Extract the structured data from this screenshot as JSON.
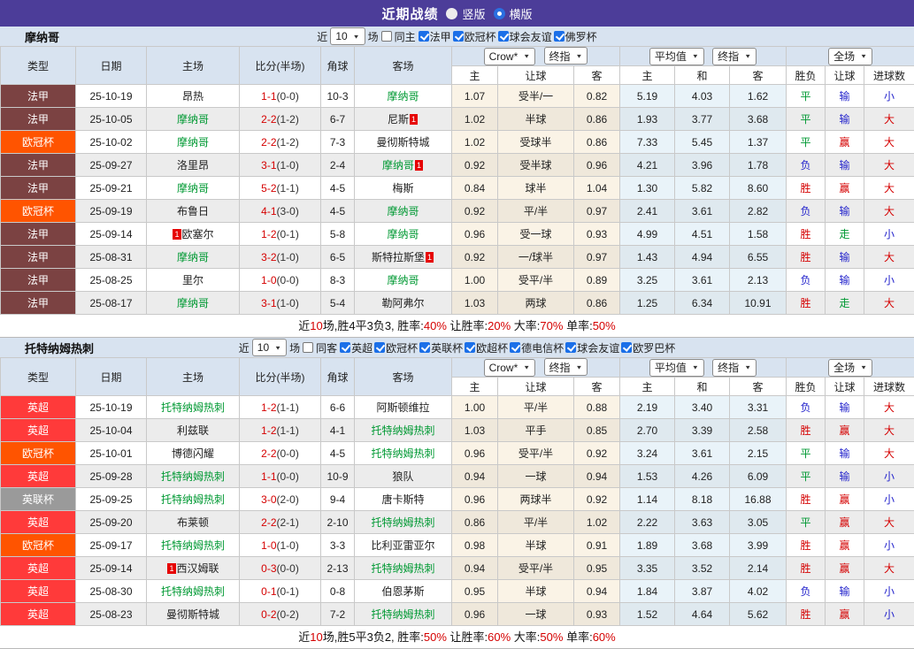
{
  "topbar": {
    "title": "近期战绩",
    "radio_vertical": "竖版",
    "radio_horizontal": "横版",
    "selected": "横版"
  },
  "table_header": {
    "col_type": "类型",
    "col_date": "日期",
    "col_home": "主场",
    "col_score": "比分(半场)",
    "col_corner": "角球",
    "col_away": "客场",
    "dd_crow": "Crow*",
    "dd_final1": "终指",
    "dd_avg": "平均值",
    "dd_final2": "终指",
    "dd_full": "全场",
    "sub": [
      "主",
      "让球",
      "客",
      "主",
      "和",
      "客",
      "胜负",
      "让球",
      "进球数"
    ]
  },
  "colors": {
    "topbar_bg": "#4c3d99",
    "section_bg": "#d8e3f0",
    "league": {
      "ligue1": "#7b4242",
      "ucl": "#ff5400",
      "epl": "#ff3a3a",
      "efl": "#9a9a9a"
    },
    "result": {
      "r": "#d50000",
      "g": "#009933",
      "b": "#2323cc"
    },
    "team_green": "#009933",
    "score_red": "#d50000",
    "badge_bg": "#e60000",
    "checkbox_blue": "#1b6fe8"
  },
  "sections": [
    {
      "team": "摩纳哥",
      "filter": {
        "near_label": "近",
        "count": "10",
        "matches_label": "场",
        "same_label": "同主",
        "leagues": [
          "法甲",
          "欧冠杯",
          "球会友谊",
          "佛罗杯"
        ]
      },
      "rows": [
        {
          "league": "法甲",
          "lc": "ligue1",
          "date": "25-10-19",
          "home": {
            "name": "昂热"
          },
          "score": "1-1",
          "half": "(0-0)",
          "corner": "10-3",
          "away": {
            "name": "摩纳哥",
            "green": true
          },
          "o": [
            "1.07",
            "受半/一",
            "0.82"
          ],
          "a": [
            "5.19",
            "4.03",
            "1.62"
          ],
          "r": [
            [
              "平",
              "g"
            ],
            [
              "输",
              "b"
            ],
            [
              "小",
              "b"
            ]
          ]
        },
        {
          "league": "法甲",
          "lc": "ligue1",
          "date": "25-10-05",
          "home": {
            "name": "摩纳哥",
            "green": true
          },
          "score": "2-2",
          "half": "(1-2)",
          "corner": "6-7",
          "away": {
            "name": "尼斯",
            "badge": "1",
            "badge_pos": "post"
          },
          "o": [
            "1.02",
            "半球",
            "0.86"
          ],
          "a": [
            "1.93",
            "3.77",
            "3.68"
          ],
          "r": [
            [
              "平",
              "g"
            ],
            [
              "输",
              "b"
            ],
            [
              "大",
              "r"
            ]
          ]
        },
        {
          "league": "欧冠杯",
          "lc": "ucl",
          "date": "25-10-02",
          "home": {
            "name": "摩纳哥",
            "green": true
          },
          "score": "2-2",
          "half": "(1-2)",
          "corner": "7-3",
          "away": {
            "name": "曼彻斯特城"
          },
          "o": [
            "1.02",
            "受球半",
            "0.86"
          ],
          "a": [
            "7.33",
            "5.45",
            "1.37"
          ],
          "r": [
            [
              "平",
              "g"
            ],
            [
              "赢",
              "r"
            ],
            [
              "大",
              "r"
            ]
          ]
        },
        {
          "league": "法甲",
          "lc": "ligue1",
          "date": "25-09-27",
          "home": {
            "name": "洛里昂"
          },
          "score": "3-1",
          "half": "(1-0)",
          "corner": "2-4",
          "away": {
            "name": "摩纳哥",
            "green": true,
            "badge": "1",
            "badge_pos": "post"
          },
          "o": [
            "0.92",
            "受半球",
            "0.96"
          ],
          "a": [
            "4.21",
            "3.96",
            "1.78"
          ],
          "r": [
            [
              "负",
              "b"
            ],
            [
              "输",
              "b"
            ],
            [
              "大",
              "r"
            ]
          ]
        },
        {
          "league": "法甲",
          "lc": "ligue1",
          "date": "25-09-21",
          "home": {
            "name": "摩纳哥",
            "green": true
          },
          "score": "5-2",
          "half": "(1-1)",
          "corner": "4-5",
          "away": {
            "name": "梅斯"
          },
          "o": [
            "0.84",
            "球半",
            "1.04"
          ],
          "a": [
            "1.30",
            "5.82",
            "8.60"
          ],
          "r": [
            [
              "胜",
              "r"
            ],
            [
              "赢",
              "r"
            ],
            [
              "大",
              "r"
            ]
          ]
        },
        {
          "league": "欧冠杯",
          "lc": "ucl",
          "date": "25-09-19",
          "home": {
            "name": "布鲁日"
          },
          "score": "4-1",
          "half": "(3-0)",
          "corner": "4-5",
          "away": {
            "name": "摩纳哥",
            "green": true
          },
          "o": [
            "0.92",
            "平/半",
            "0.97"
          ],
          "a": [
            "2.41",
            "3.61",
            "2.82"
          ],
          "r": [
            [
              "负",
              "b"
            ],
            [
              "输",
              "b"
            ],
            [
              "大",
              "r"
            ]
          ]
        },
        {
          "league": "法甲",
          "lc": "ligue1",
          "date": "25-09-14",
          "home": {
            "name": "欧塞尔",
            "badge": "1",
            "badge_pos": "pre"
          },
          "score": "1-2",
          "half": "(0-1)",
          "corner": "5-8",
          "away": {
            "name": "摩纳哥",
            "green": true
          },
          "o": [
            "0.96",
            "受一球",
            "0.93"
          ],
          "a": [
            "4.99",
            "4.51",
            "1.58"
          ],
          "r": [
            [
              "胜",
              "r"
            ],
            [
              "走",
              "g"
            ],
            [
              "小",
              "b"
            ]
          ]
        },
        {
          "league": "法甲",
          "lc": "ligue1",
          "date": "25-08-31",
          "home": {
            "name": "摩纳哥",
            "green": true
          },
          "score": "3-2",
          "half": "(1-0)",
          "corner": "6-5",
          "away": {
            "name": "斯特拉斯堡",
            "badge": "1",
            "badge_pos": "post"
          },
          "o": [
            "0.92",
            "一/球半",
            "0.97"
          ],
          "a": [
            "1.43",
            "4.94",
            "6.55"
          ],
          "r": [
            [
              "胜",
              "r"
            ],
            [
              "输",
              "b"
            ],
            [
              "大",
              "r"
            ]
          ]
        },
        {
          "league": "法甲",
          "lc": "ligue1",
          "date": "25-08-25",
          "home": {
            "name": "里尔"
          },
          "score": "1-0",
          "half": "(0-0)",
          "corner": "8-3",
          "away": {
            "name": "摩纳哥",
            "green": true
          },
          "o": [
            "1.00",
            "受平/半",
            "0.89"
          ],
          "a": [
            "3.25",
            "3.61",
            "2.13"
          ],
          "r": [
            [
              "负",
              "b"
            ],
            [
              "输",
              "b"
            ],
            [
              "小",
              "b"
            ]
          ]
        },
        {
          "league": "法甲",
          "lc": "ligue1",
          "date": "25-08-17",
          "home": {
            "name": "摩纳哥",
            "green": true
          },
          "score": "3-1",
          "half": "(1-0)",
          "corner": "5-4",
          "away": {
            "name": "勒阿弗尔"
          },
          "o": [
            "1.03",
            "两球",
            "0.86"
          ],
          "a": [
            "1.25",
            "6.34",
            "10.91"
          ],
          "r": [
            [
              "胜",
              "r"
            ],
            [
              "走",
              "g"
            ],
            [
              "大",
              "r"
            ]
          ]
        }
      ],
      "summary": [
        [
          "近",
          "k"
        ],
        [
          "10",
          "r"
        ],
        [
          "场,胜4平3负3, 胜率:",
          "k"
        ],
        [
          "40%",
          "r"
        ],
        [
          " 让胜率:",
          "k"
        ],
        [
          "20%",
          "r"
        ],
        [
          " 大率:",
          "k"
        ],
        [
          "70%",
          "r"
        ],
        [
          " 单率:",
          "k"
        ],
        [
          "50%",
          "r"
        ]
      ]
    },
    {
      "team": "托特纳姆热刺",
      "filter": {
        "near_label": "近",
        "count": "10",
        "matches_label": "场",
        "same_label": "同客",
        "leagues": [
          "英超",
          "欧冠杯",
          "英联杯",
          "欧超杯",
          "德电信杯",
          "球会友谊",
          "欧罗巴杯"
        ]
      },
      "rows": [
        {
          "league": "英超",
          "lc": "epl",
          "date": "25-10-19",
          "home": {
            "name": "托特纳姆热刺",
            "green": true
          },
          "score": "1-2",
          "half": "(1-1)",
          "corner": "6-6",
          "away": {
            "name": "阿斯顿维拉"
          },
          "o": [
            "1.00",
            "平/半",
            "0.88"
          ],
          "a": [
            "2.19",
            "3.40",
            "3.31"
          ],
          "r": [
            [
              "负",
              "b"
            ],
            [
              "输",
              "b"
            ],
            [
              "大",
              "r"
            ]
          ]
        },
        {
          "league": "英超",
          "lc": "epl",
          "date": "25-10-04",
          "home": {
            "name": "利兹联"
          },
          "score": "1-2",
          "half": "(1-1)",
          "corner": "4-1",
          "away": {
            "name": "托特纳姆热刺",
            "green": true
          },
          "o": [
            "1.03",
            "平手",
            "0.85"
          ],
          "a": [
            "2.70",
            "3.39",
            "2.58"
          ],
          "r": [
            [
              "胜",
              "r"
            ],
            [
              "赢",
              "r"
            ],
            [
              "大",
              "r"
            ]
          ]
        },
        {
          "league": "欧冠杯",
          "lc": "ucl",
          "date": "25-10-01",
          "home": {
            "name": "博德闪耀"
          },
          "score": "2-2",
          "half": "(0-0)",
          "corner": "4-5",
          "away": {
            "name": "托特纳姆热刺",
            "green": true
          },
          "o": [
            "0.96",
            "受平/半",
            "0.92"
          ],
          "a": [
            "3.24",
            "3.61",
            "2.15"
          ],
          "r": [
            [
              "平",
              "g"
            ],
            [
              "输",
              "b"
            ],
            [
              "大",
              "r"
            ]
          ]
        },
        {
          "league": "英超",
          "lc": "epl",
          "date": "25-09-28",
          "home": {
            "name": "托特纳姆热刺",
            "green": true
          },
          "score": "1-1",
          "half": "(0-0)",
          "corner": "10-9",
          "away": {
            "name": "狼队"
          },
          "o": [
            "0.94",
            "一球",
            "0.94"
          ],
          "a": [
            "1.53",
            "4.26",
            "6.09"
          ],
          "r": [
            [
              "平",
              "g"
            ],
            [
              "输",
              "b"
            ],
            [
              "小",
              "b"
            ]
          ]
        },
        {
          "league": "英联杯",
          "lc": "efl",
          "date": "25-09-25",
          "home": {
            "name": "托特纳姆热刺",
            "green": true
          },
          "score": "3-0",
          "half": "(2-0)",
          "corner": "9-4",
          "away": {
            "name": "唐卡斯特"
          },
          "o": [
            "0.96",
            "两球半",
            "0.92"
          ],
          "a": [
            "1.14",
            "8.18",
            "16.88"
          ],
          "r": [
            [
              "胜",
              "r"
            ],
            [
              "赢",
              "r"
            ],
            [
              "小",
              "b"
            ]
          ]
        },
        {
          "league": "英超",
          "lc": "epl",
          "date": "25-09-20",
          "home": {
            "name": "布莱顿"
          },
          "score": "2-2",
          "half": "(2-1)",
          "corner": "2-10",
          "away": {
            "name": "托特纳姆热刺",
            "green": true
          },
          "o": [
            "0.86",
            "平/半",
            "1.02"
          ],
          "a": [
            "2.22",
            "3.63",
            "3.05"
          ],
          "r": [
            [
              "平",
              "g"
            ],
            [
              "赢",
              "r"
            ],
            [
              "大",
              "r"
            ]
          ]
        },
        {
          "league": "欧冠杯",
          "lc": "ucl",
          "date": "25-09-17",
          "home": {
            "name": "托特纳姆热刺",
            "green": true
          },
          "score": "1-0",
          "half": "(1-0)",
          "corner": "3-3",
          "away": {
            "name": "比利亚雷亚尔"
          },
          "o": [
            "0.98",
            "半球",
            "0.91"
          ],
          "a": [
            "1.89",
            "3.68",
            "3.99"
          ],
          "r": [
            [
              "胜",
              "r"
            ],
            [
              "赢",
              "r"
            ],
            [
              "小",
              "b"
            ]
          ]
        },
        {
          "league": "英超",
          "lc": "epl",
          "date": "25-09-14",
          "home": {
            "name": "西汉姆联",
            "badge": "1",
            "badge_pos": "pre"
          },
          "score": "0-3",
          "half": "(0-0)",
          "corner": "2-13",
          "away": {
            "name": "托特纳姆热刺",
            "green": true
          },
          "o": [
            "0.94",
            "受平/半",
            "0.95"
          ],
          "a": [
            "3.35",
            "3.52",
            "2.14"
          ],
          "r": [
            [
              "胜",
              "r"
            ],
            [
              "赢",
              "r"
            ],
            [
              "大",
              "r"
            ]
          ]
        },
        {
          "league": "英超",
          "lc": "epl",
          "date": "25-08-30",
          "home": {
            "name": "托特纳姆热刺",
            "green": true
          },
          "score": "0-1",
          "half": "(0-1)",
          "corner": "0-8",
          "away": {
            "name": "伯恩茅斯"
          },
          "o": [
            "0.95",
            "半球",
            "0.94"
          ],
          "a": [
            "1.84",
            "3.87",
            "4.02"
          ],
          "r": [
            [
              "负",
              "b"
            ],
            [
              "输",
              "b"
            ],
            [
              "小",
              "b"
            ]
          ]
        },
        {
          "league": "英超",
          "lc": "epl",
          "date": "25-08-23",
          "home": {
            "name": "曼彻斯特城"
          },
          "score": "0-2",
          "half": "(0-2)",
          "corner": "7-2",
          "away": {
            "name": "托特纳姆热刺",
            "green": true
          },
          "o": [
            "0.96",
            "一球",
            "0.93"
          ],
          "a": [
            "1.52",
            "4.64",
            "5.62"
          ],
          "r": [
            [
              "胜",
              "r"
            ],
            [
              "赢",
              "r"
            ],
            [
              "小",
              "b"
            ]
          ]
        }
      ],
      "summary": [
        [
          "近",
          "k"
        ],
        [
          "10",
          "r"
        ],
        [
          "场,胜5平3负2, 胜率:",
          "k"
        ],
        [
          "50%",
          "r"
        ],
        [
          " 让胜率:",
          "k"
        ],
        [
          "60%",
          "r"
        ],
        [
          " 大率:",
          "k"
        ],
        [
          "50%",
          "r"
        ],
        [
          " 单率:",
          "k"
        ],
        [
          "60%",
          "r"
        ]
      ]
    }
  ]
}
